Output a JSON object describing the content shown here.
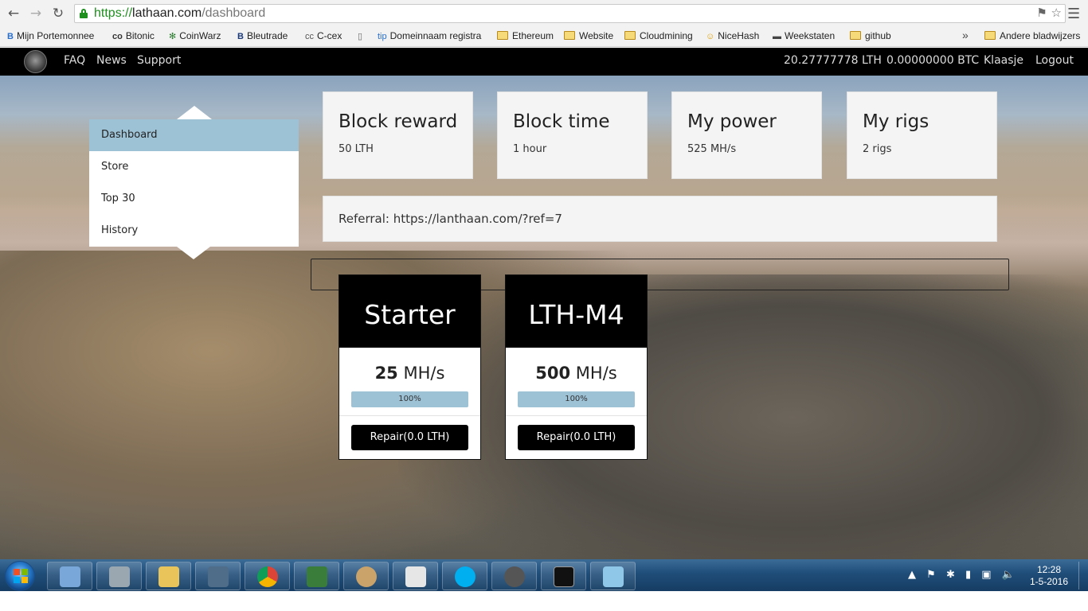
{
  "browser": {
    "url_protocol": "https://",
    "url_host": "lathaan.com",
    "url_path": "/dashboard",
    "bookmarks": [
      {
        "label": "Mijn Portemonnee",
        "icon": "B"
      },
      {
        "label": "Bitonic",
        "icon": "co"
      },
      {
        "label": "CoinWarz",
        "icon": "✻"
      },
      {
        "label": "Bleutrade",
        "icon": "B"
      },
      {
        "label": "C-cex",
        "icon": "cc"
      },
      {
        "label": "",
        "icon": "▯"
      },
      {
        "label": "Domeinnaam registra",
        "icon": "tip"
      },
      {
        "label": "Ethereum",
        "icon": "folder"
      },
      {
        "label": "Website",
        "icon": "folder"
      },
      {
        "label": "Cloudmining",
        "icon": "folder"
      },
      {
        "label": "NiceHash",
        "icon": "☺"
      },
      {
        "label": "Weekstaten",
        "icon": "▬"
      },
      {
        "label": "github",
        "icon": "folder"
      }
    ],
    "overflow": "»",
    "other_bookmarks": "Andere bladwijzers"
  },
  "nav": {
    "links": [
      "FAQ",
      "News",
      "Support"
    ],
    "balance_lth": "20.27777778 LTH",
    "balance_btc": "0.00000000 BTC",
    "user": "Klaasje",
    "logout": "Logout"
  },
  "sidebar": {
    "items": [
      {
        "label": "Dashboard",
        "active": true
      },
      {
        "label": "Store",
        "active": false
      },
      {
        "label": "Top 30",
        "active": false
      },
      {
        "label": "History",
        "active": false
      }
    ]
  },
  "stats": [
    {
      "title": "Block reward",
      "value": "50 LTH"
    },
    {
      "title": "Block time",
      "value": "1 hour"
    },
    {
      "title": "My power",
      "value": "525 MH/s"
    },
    {
      "title": "My rigs",
      "value": "2 rigs"
    }
  ],
  "referral": "Referral: https://lanthaan.com/?ref=7",
  "rigs": [
    {
      "name": "Starter",
      "hash_value": "25",
      "hash_unit": "MH/s",
      "condition_label": "100%",
      "condition": 1.0,
      "button": "Repair(0.0 LTH)"
    },
    {
      "name": "LTH-M4",
      "hash_value": "500",
      "hash_unit": "MH/s",
      "condition_label": "100%",
      "condition": 1.0,
      "button": "Repair(0.0 LTH)"
    }
  ],
  "taskbar": {
    "time": "12:28",
    "date": "1-5-2016"
  },
  "colors": {
    "accent": "#9dc2d6",
    "nav_bg": "#000000",
    "card_bg": "#f4f4f4"
  }
}
